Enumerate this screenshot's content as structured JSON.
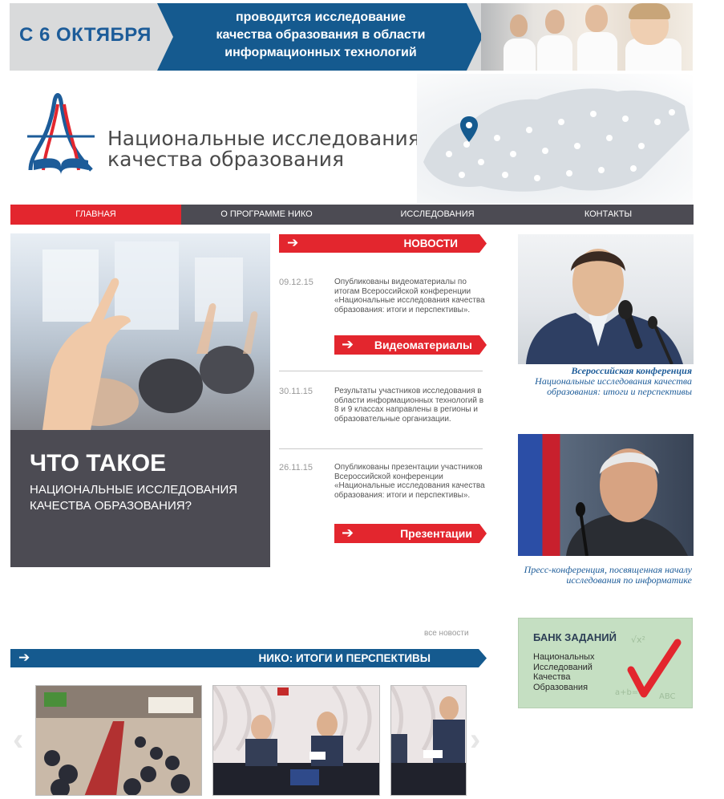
{
  "banner": {
    "date": "С 6 ОКТЯБРЯ",
    "line1": "проводится исследование",
    "line2": "качества образования в области",
    "line3": "информационных технологий"
  },
  "brand": {
    "line1": "Национальные исследования",
    "line2": "качества образования"
  },
  "nav": [
    "ГЛАВНАЯ",
    "О ПРОГРАММЕ НИКО",
    "ИССЛЕДОВАНИЯ",
    "КОНТАКТЫ"
  ],
  "promo": {
    "title": "ЧТО ТАКОЕ",
    "subtitle": "НАЦИОНАЛЬНЫЕ ИССЛЕДОВАНИЯ КАЧЕСТВА ОБРАЗОВАНИЯ?"
  },
  "news": {
    "title": "НОВОСТИ",
    "items": [
      {
        "date": "09.12.15",
        "text": "Опубликованы видеоматериалы по итогам Всероссийской конференции «Национальные исследования качества образования: итоги и перспективы»."
      },
      {
        "date": "30.11.15",
        "text": "Результаты участников исследования в области информационных технологий в 8 и 9 классах направлены в регионы и образовательные организации."
      },
      {
        "date": "26.11.15",
        "text": "Опубликованы презентации участников Всероссийской конференции «Национальные исследования качества образования: итоги и перспективы»."
      }
    ],
    "btn_video": "Видеоматериалы",
    "btn_presentations": "Презентации",
    "all_news": "все новости"
  },
  "side": {
    "caption1_bold": "Всероссийская конференция",
    "caption1_rest": "Национальные исследования качества образования: итоги и перспективы",
    "caption2": "Пресс-конференция, посвященная началу исследования по информатике",
    "bank_title": "БАНК ЗАДАНИЙ",
    "bank_desc": "Национальных Исследований Качества Образования"
  },
  "gallery": {
    "title": "НИКО: ИТОГИ И ПЕРСПЕКТИВЫ"
  },
  "colors": {
    "red": "#e3262e",
    "blue": "#155a8f",
    "dark": "#4c4b53"
  }
}
